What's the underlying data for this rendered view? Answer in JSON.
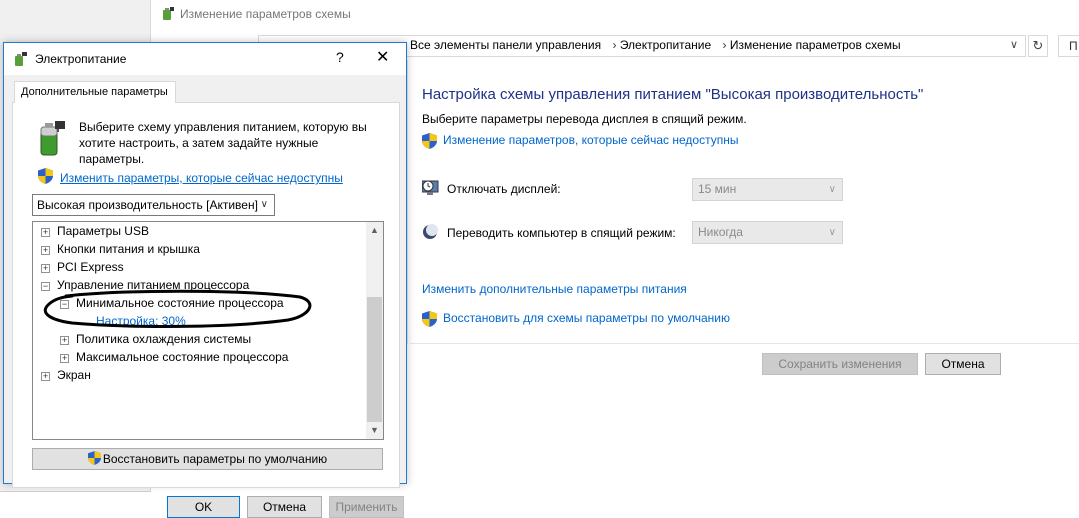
{
  "background_window": {
    "title": "Изменение параметров схемы",
    "breadcrumbs": [
      "Все элементы панели управления",
      "Электропитание",
      "Изменение параметров схемы"
    ],
    "breadcrumb_sep": "›",
    "address_dropdown": "∨",
    "refresh": "↻",
    "search_fragment": "П",
    "heading": "Настройка схемы управления питанием \"Высокая производительность\"",
    "subheading": "Выберите параметры перевода дисплея в спящий режим.",
    "change_unavailable_link": "Изменение параметров, которые сейчас недоступны",
    "display_off_label": "Отключать дисплей:",
    "display_off_value": "15 мин",
    "sleep_label": "Переводить компьютер в спящий режим:",
    "sleep_value": "Никогда",
    "advanced_link": "Изменить дополнительные параметры питания",
    "restore_link": "Восстановить для схемы параметры по умолчанию",
    "save_button": "Сохранить изменения",
    "cancel_button": "Отмена"
  },
  "dialog": {
    "title": "Электропитание",
    "help_glyph": "?",
    "close_glyph": "✕",
    "tab_label": "Дополнительные параметры",
    "intro": "Выберите схему управления питанием, которую вы хотите настроить, а затем задайте нужные параметры.",
    "change_link": "Изменить параметры, которые сейчас недоступны",
    "plan_selected": "Высокая производительность [Активен]",
    "tree": [
      {
        "expander": "+",
        "label": "Параметры USB",
        "link": false
      },
      {
        "expander": "+",
        "label": "Кнопки питания и крышка",
        "link": false
      },
      {
        "expander": "+",
        "label": "PCI Express",
        "link": false
      },
      {
        "expander": "−",
        "label": "Управление питанием процессора",
        "link": false
      },
      {
        "expander": "−",
        "label": "Минимальное состояние процессора",
        "link": false
      },
      {
        "expander": "",
        "label": "Настройка: 30%",
        "link": true
      },
      {
        "expander": "+",
        "label": "Политика охлаждения системы",
        "link": false
      },
      {
        "expander": "+",
        "label": "Максимальное состояние процессора",
        "link": false
      },
      {
        "expander": "+",
        "label": "Экран",
        "link": false
      }
    ],
    "restore_button": "Восстановить параметры по умолчанию",
    "ok_button": "OK",
    "cancel_button": "Отмена",
    "apply_button": "Применить"
  },
  "icons": {
    "title_icon": "power-options-icon",
    "shield": "uac-shield-icon",
    "battery": "battery-plug-icon",
    "display": "display-clock-icon",
    "sleep": "moon-sleep-icon"
  },
  "colors": {
    "heading_blue": "#1e3287",
    "link_blue": "#0066cc",
    "dialog_border": "#1e7bd0"
  }
}
